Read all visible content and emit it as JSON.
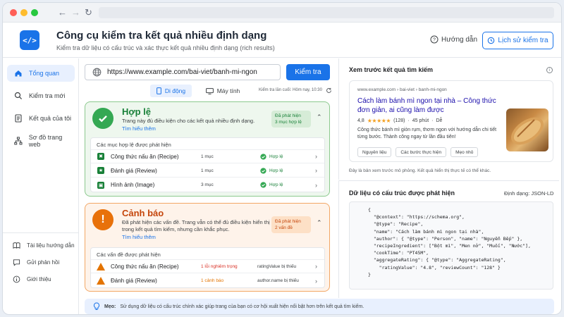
{
  "app": {
    "title": "Công cụ kiểm tra kết quả nhiều định dạng",
    "subtitle": "Kiểm tra dữ liệu có cấu trúc và xác thực kết quả nhiều định dạng (rich results)",
    "guide_label": "Hướng dẫn",
    "history_label": "Lịch sử kiểm tra",
    "logo_glyph": "</>"
  },
  "sidebar": {
    "items": [
      {
        "label": "Tổng quan",
        "icon": "home-icon"
      },
      {
        "label": "Kiểm tra mới",
        "icon": "search-icon"
      },
      {
        "label": "Kết quả của tôi",
        "icon": "document-icon"
      },
      {
        "label": "Sơ đồ trang web",
        "icon": "sitemap-icon"
      }
    ],
    "footer": [
      {
        "label": "Tài liệu hướng dẫn",
        "icon": "book-icon"
      },
      {
        "label": "Gửi phản hồi",
        "icon": "feedback-icon"
      },
      {
        "label": "Giới thiệu",
        "icon": "info-icon"
      }
    ]
  },
  "check": {
    "url": "https://www.example.com/bai-viet/banh-mi-ngon",
    "button": "Kiểm tra",
    "mobile": "Di động",
    "desktop": "Máy tính",
    "last_checked": "Kiểm tra lần cuối: Hôm nay, 10:30"
  },
  "valid": {
    "title": "Hợp lệ",
    "desc": "Trang này đủ điều kiện cho các kết quả nhiều định dạng.",
    "link": "Tìm hiểu thêm",
    "badge_line1": "Đã phát hiện",
    "badge_line2": "3 mục hợp lệ",
    "list_header": "Các mục hợp lệ được phát hiện",
    "rows": [
      {
        "name": "Công thức nấu ăn (Recipe)",
        "count": "1 mục",
        "status": "Hợp lệ"
      },
      {
        "name": "Đánh giá (Review)",
        "count": "1 mục",
        "status": "Hợp lệ"
      },
      {
        "name": "Hình ảnh (Image)",
        "count": "3 mục",
        "status": "Hợp lệ"
      }
    ]
  },
  "warning": {
    "title": "Cảnh báo",
    "desc": "Đã phát hiện các vấn đề. Trang vẫn có thể đủ điều kiện hiển thị trong kết quả tìm kiếm, nhưng cần khắc phục.",
    "link": "Tìm hiểu thêm",
    "badge_line1": "Đã phát hiện",
    "badge_line2": "2 vấn đề",
    "list_header": "Các vấn đề được phát hiện",
    "rows": [
      {
        "name": "Công thức nấu ăn (Recipe)",
        "issue": "1 lỗi nghiêm trọng",
        "field": "ratingValue bị thiếu"
      },
      {
        "name": "Đánh giá (Review)",
        "issue": "1 cảnh báo",
        "field": "author.name bị thiếu"
      }
    ]
  },
  "preview": {
    "title": "Xem trước kết quả tìm kiếm",
    "url": "www.example.com › bai-viet › banh-mi-ngon",
    "headline": "Cách làm bánh mì ngon tại nhà – Công thức đơn giản, ai cũng làm được",
    "rating": "4,8",
    "stars": "★★★★★",
    "reviews": "(128)",
    "time": "45 phút",
    "difficulty": "Dễ",
    "snippet": "Công thức bánh mì giòn rụm, thơm ngon với hướng dẫn chi tiết từng bước. Thành công ngay từ lần đầu tiên!",
    "tags": [
      "Nguyên liệu",
      "Các bước thực hiện",
      "Mẹo nhỏ"
    ],
    "note": "Đây là bản xem trước mô phỏng. Kết quả hiển thị thực tế có thể khác."
  },
  "structured": {
    "title": "Dữ liệu có cấu trúc được phát hiện",
    "format": "Định dạng: JSON-LD",
    "lines": [
      "{",
      "  \"@context\": \"https://schema.org\",",
      "  \"@type\": \"Recipe\",",
      "  \"name\": \"Cách làm bánh mì ngon tại nhà\",",
      "  \"author\": { \"@type\": \"Person\", \"name\": \"Nguyễn Bếp\" },",
      "  \"recipeIngredient\": [\"Bột mì\", \"Men nở\", \"Muối\", \"Nước\"],",
      "  \"cookTime\": \"PT45M\",",
      "  \"aggregateRating\": { \"@type\": \"AggregateRating\",",
      "    \"ratingValue\": \"4.8\", \"reviewCount\": \"128\" }",
      "}"
    ]
  },
  "tip": {
    "label": "Mẹo:",
    "text": "Sử dụng dữ liệu có cấu trúc chính xác giúp trang của bạn có cơ hội xuất hiện nổi bật hơn trên kết quả tìm kiếm."
  },
  "colors": {
    "accent": "#1a73e8",
    "valid": "#34a853",
    "warning": "#e37400",
    "error": "#d93025"
  }
}
